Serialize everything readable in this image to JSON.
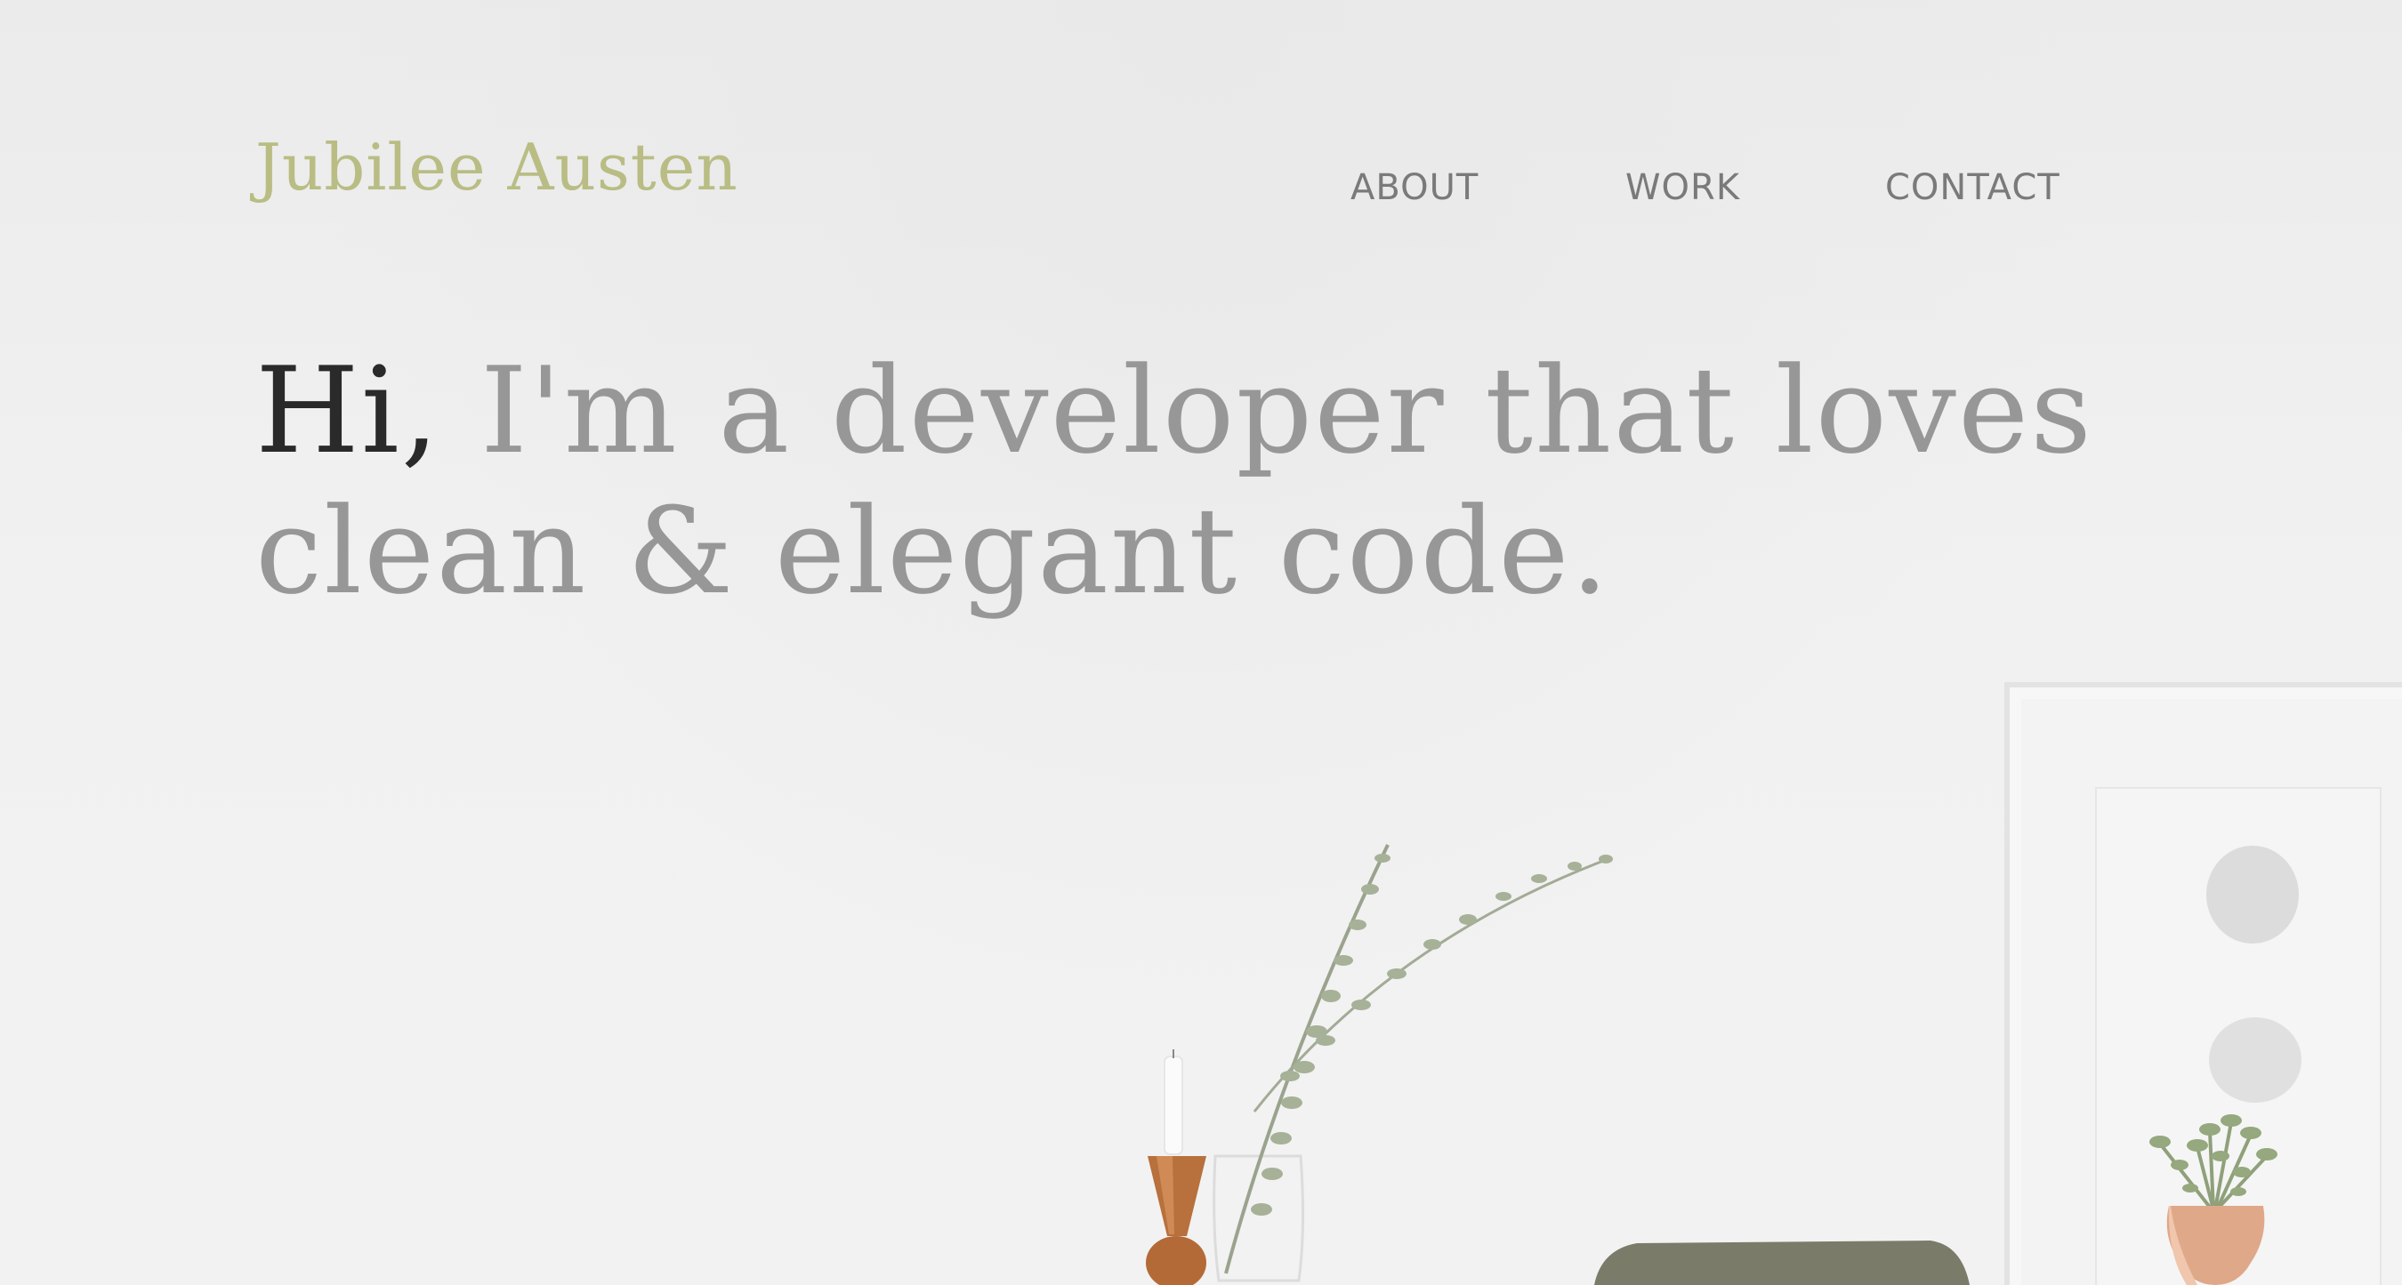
{
  "header": {
    "logo": "Jubilee Austen",
    "nav": [
      {
        "label": "ABOUT"
      },
      {
        "label": "WORK"
      },
      {
        "label": "CONTACT"
      }
    ]
  },
  "hero": {
    "greeting": "Hi,",
    "line1_rest": "I'm a developer that loves",
    "line2": "clean & elegant code."
  },
  "colors": {
    "background": "#eeeeee",
    "logo": "#b9bd84",
    "nav_text": "#7a7a7a",
    "heading_muted": "#979797",
    "heading_accent": "#2a2a2a"
  }
}
